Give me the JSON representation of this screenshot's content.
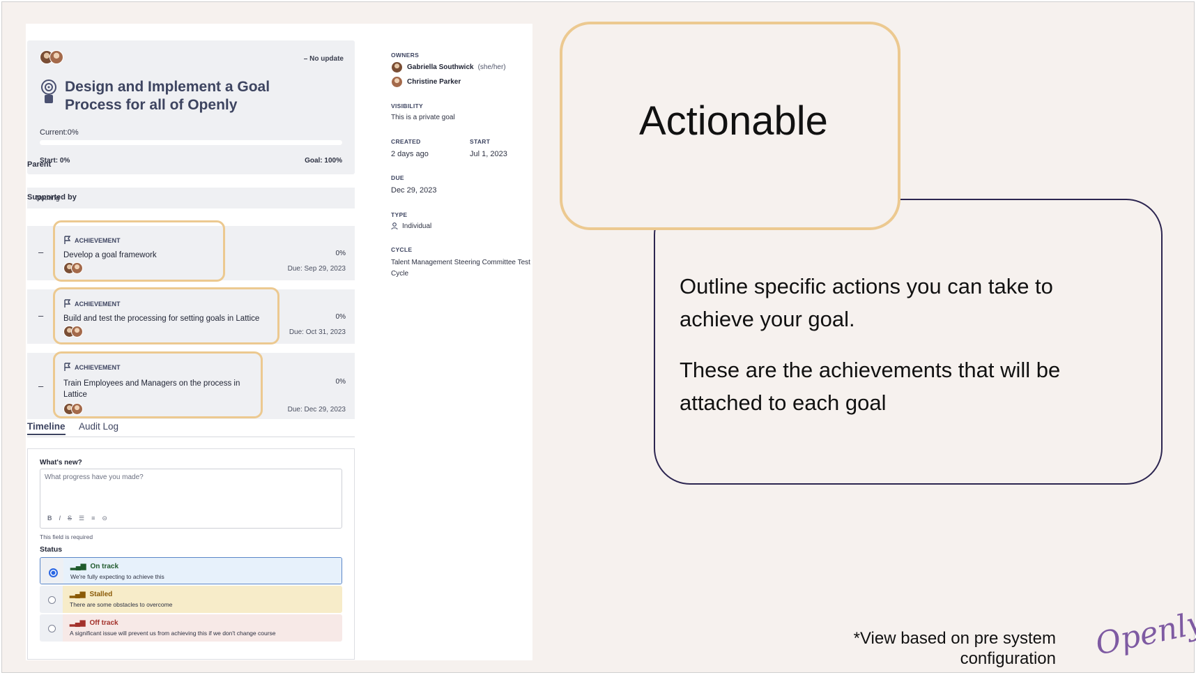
{
  "goal": {
    "update_status": "– No update",
    "title": "Design and Implement a Goal Process for all of Openly",
    "current": "Current:0%",
    "progress": 0,
    "start": "Start: 0%",
    "goal": "Goal: 100%"
  },
  "parent": {
    "label": "Parent",
    "value": "Nothing"
  },
  "supported": {
    "label": "Supported by",
    "items": [
      {
        "kind": "ACHIEVEMENT",
        "name": "Develop a goal framework",
        "pct": "0%",
        "due": "Due: Sep 29, 2023"
      },
      {
        "kind": "ACHIEVEMENT",
        "name": "Build and test the processing for setting goals in Lattice",
        "pct": "0%",
        "due": "Due: Oct 31, 2023"
      },
      {
        "kind": "ACHIEVEMENT",
        "name": "Train Employees and Managers on the process in Lattice",
        "pct": "0%",
        "due": "Due: Dec 29, 2023"
      }
    ]
  },
  "tabs": [
    "Timeline",
    "Audit Log"
  ],
  "composer": {
    "heading": "What's new?",
    "placeholder": "What progress have you made?",
    "toolbar": [
      "B",
      "I",
      "S",
      "☰",
      "≡",
      "⊝"
    ],
    "required": "This field is required",
    "status_label": "Status",
    "options": [
      {
        "title": "On track",
        "desc": "We're fully expecting to achieve this",
        "color": "#e7f1fb",
        "text_color": "#1f5a2c"
      },
      {
        "title": "Stalled",
        "desc": "There are some obstacles to overcome",
        "color": "#f7ecc9",
        "text_color": "#8a5a07"
      },
      {
        "title": "Off track",
        "desc": "A significant issue will prevent us from achieving this if we don't change course",
        "color": "#f7e9e7",
        "text_color": "#a3312b"
      }
    ]
  },
  "meta": {
    "owners_h": "OWNERS",
    "owner1": "Gabriella Southwick",
    "owner1_pron": "(she/her)",
    "owner2": "Christine Parker",
    "visibility_h": "VISIBILITY",
    "visibility": "This is a private goal",
    "created_h": "CREATED",
    "created": "2 days ago",
    "start_h": "START",
    "start": "Jul 1, 2023",
    "due_h": "DUE",
    "due": "Dec 29, 2023",
    "type_h": "TYPE",
    "type": "Individual",
    "cycle_h": "CYCLE",
    "cycle": "Talent Management Steering Committee Test Cycle"
  },
  "slide": {
    "heading": "Actionable",
    "p1": "Outline specific actions you can take to achieve your goal.",
    "p2": "These are the achievements that will be attached to each goal",
    "footnote_1": "*View based on pre system",
    "footnote_2": "configuration",
    "logo": "Openly",
    "accent": "#ecc990",
    "border": "#2c2550"
  }
}
